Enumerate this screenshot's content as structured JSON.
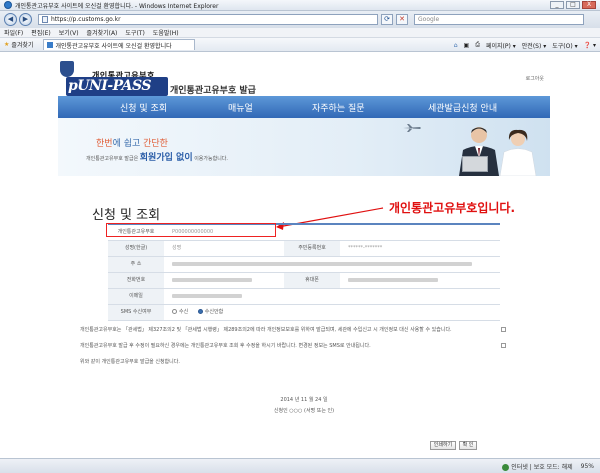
{
  "window": {
    "title": "개인통관고유부호 사이트에 오신걸 환영합니다. - Windows Internet Explorer",
    "minimize": "_",
    "maximize": "□",
    "close": "X"
  },
  "address_bar": {
    "back": "◀",
    "forward": "▶",
    "url": "https://p.customs.go.kr",
    "search_placeholder": "Google"
  },
  "menu": {
    "items": [
      "파일(F)",
      "편집(E)",
      "보기(V)",
      "즐겨찾기(A)",
      "도구(T)",
      "도움말(H)"
    ]
  },
  "favorites_bar": {
    "label": "즐겨찾기",
    "tab_title": "개인통관고유부호 사이트에 오신걸 환영합니다",
    "commands": [
      "페이지(P) ▾",
      "안전(S) ▾",
      "도구(O) ▾",
      "❓ ▾"
    ]
  },
  "site": {
    "org_name": "개인통관고유부호",
    "logo": "pUNI-PASS",
    "logo_sub": "개인통관고유부호 발급",
    "login": "로그아웃"
  },
  "nav": {
    "items": [
      "신청 및 조회",
      "매뉴얼",
      "자주하는 질문",
      "세관발급신청 안내"
    ]
  },
  "banner": {
    "line1_a": "한번",
    "line1_b": "에 쉽고 ",
    "line1_c": "간단한",
    "line2_a": "개인통관고유부호 발급은 ",
    "line2_b": "회원가입 없이",
    "line2_c": " 이용가능합니다."
  },
  "section": {
    "title": "신청 및 조회",
    "callout": "개인통관고유부호입니다."
  },
  "form": {
    "rows": [
      {
        "label": "개인통관고유부호",
        "value": "P000000000000"
      },
      {
        "label": "성명(한글)",
        "value": "성명",
        "label2": "주민등록번호",
        "value2": "******-*******"
      },
      {
        "label": "주 소",
        "value": ""
      },
      {
        "label": "전화번호",
        "value": "",
        "label2": "휴대폰",
        "value2": ""
      },
      {
        "label": "이메일",
        "value": ""
      },
      {
        "label": "SMS 수신여부",
        "radio_on": "수신",
        "radio_off": "수신안함"
      }
    ]
  },
  "notices": [
    "개인통관고유부호는 「관세법」 제327조의2 및 「관세법 시행령」 제289조의2에 따라 개인정보보호를 위하여 발급되며, 세관에 수입신고 시 개인정보 대신 사용할 수 있습니다.",
    "개인통관고유부호 발급 후 수정이 필요하신 경우에는 개인통관고유부호 조회 후 수정을 하시기 바랍니다. 변경된 정보는 SMS로 안내됩니다.",
    "위와 같이 개인통관고유부호 발급을 신청합니다."
  ],
  "footer": {
    "date": "2014 년 11 월 24 일",
    "applicant": "신청인 ○○○ (서명 또는 인)",
    "print_button": "인쇄하기",
    "confirm_button": "확 인"
  },
  "statusbar": {
    "zone": "인터넷 | 보호 모드: 해제",
    "zoom": "95%"
  }
}
